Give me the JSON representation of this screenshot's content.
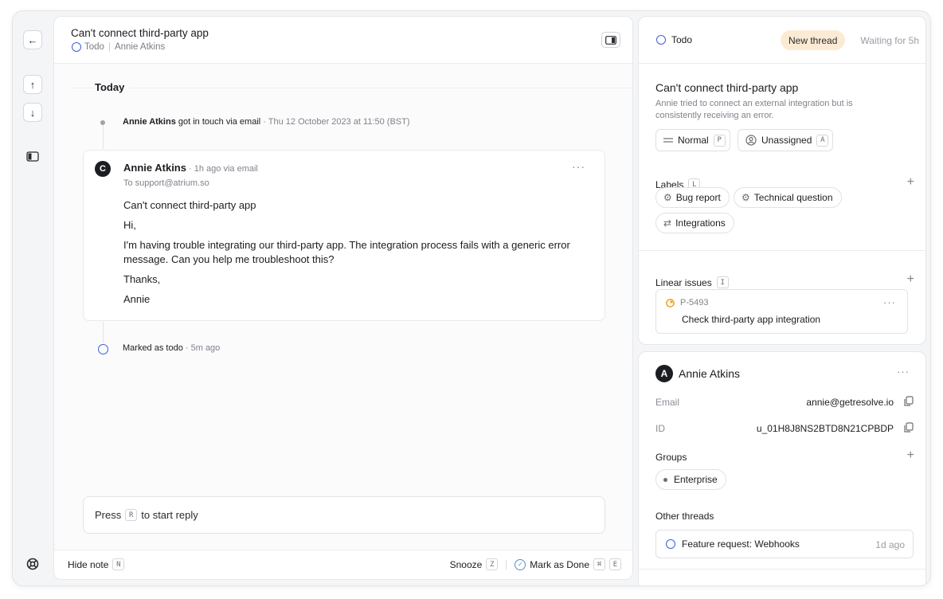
{
  "rail": {
    "back_icon": "arrow-left-icon",
    "up_icon": "arrow-up-icon",
    "down_icon": "arrow-down-icon",
    "sidebar_icon": "sidebar-icon",
    "help_icon": "lifebuoy-icon"
  },
  "header": {
    "title": "Can't connect third-party app",
    "status": "Todo",
    "assignee": "Annie Atkins"
  },
  "timeline": {
    "day_label": "Today",
    "event_actor": "Annie Atkins",
    "event_action": " got in touch via email",
    "event_time": " · Thu 12 October 2023 at 11:50 (BST)",
    "message": {
      "avatar_letter": "C",
      "author": "Annie Atkins",
      "meta": " · 1h ago via email",
      "to": "To support@atrium.so",
      "subject": "Can't connect third-party app",
      "greeting": "Hi,",
      "body": "I'm having trouble integrating our third-party app. The integration process fails with a generic error message. Can you help me troubleshoot this?",
      "signoff": "Thanks,",
      "signature": "Annie"
    },
    "todo_event": "Marked as todo",
    "todo_time": " · 5m ago"
  },
  "reply": {
    "prefix": "Press",
    "key": "R",
    "suffix": "to start reply"
  },
  "footer": {
    "hide_note": "Hide note",
    "hide_note_key": "N",
    "snooze": "Snooze",
    "snooze_key": "Z",
    "mark_done": "Mark as Done",
    "mark_done_key1": "⌘",
    "mark_done_key2": "E"
  },
  "sidebar": {
    "status": "Todo",
    "new_thread": "New thread",
    "waiting": "Waiting for 5h",
    "title": "Can't connect third-party app",
    "description": "Annie tried to connect an external integration but is consistently receiving an error.",
    "priority": "Normal",
    "priority_key": "P",
    "assignee": "Unassigned",
    "assignee_key": "A",
    "labels_heading": "Labels",
    "labels_key": "L",
    "labels": [
      "Bug report",
      "Technical question",
      "Integrations"
    ],
    "linear_heading": "Linear issues",
    "linear_key": "I",
    "issue_id": "P-5493",
    "issue_title": "Check third-party app integration"
  },
  "contact": {
    "avatar_letter": "A",
    "name": "Annie Atkins",
    "email_label": "Email",
    "email": "annie@getresolve.io",
    "id_label": "ID",
    "id": "u_01H8J8NS2BTD8N21CPBDP",
    "groups_heading": "Groups",
    "group": "Enterprise",
    "other_threads_heading": "Other threads",
    "other_thread_title": "Feature request: Webhooks",
    "other_thread_time": "1d ago"
  },
  "colors": {
    "accent_blue": "#3d5fd9",
    "new_thread_bg": "#fcebd4",
    "issue_orange": "#f0a020"
  }
}
